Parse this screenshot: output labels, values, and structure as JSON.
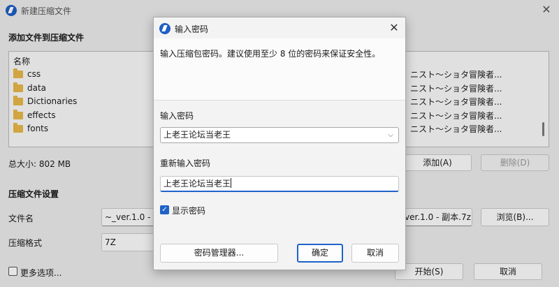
{
  "background_window": {
    "title": "新建压缩文件",
    "close_glyph": "✕",
    "add_files_heading": "添加文件到压缩文件",
    "file_list": {
      "column_header": "名称",
      "items": [
        {
          "name": "css",
          "right_text": "ニスト～ショタ冒険者..."
        },
        {
          "name": "data",
          "right_text": "ニスト～ショタ冒険者..."
        },
        {
          "name": "Dictionaries",
          "right_text": "ニスト～ショタ冒険者..."
        },
        {
          "name": "effects",
          "right_text": "ニスト～ショタ冒険者..."
        },
        {
          "name": "fonts",
          "right_text": "ニスト～ショタ冒険者..."
        }
      ]
    },
    "total_size": "总大小: 802 MB",
    "add_button": "添加(A)",
    "delete_button": "删除(D)",
    "settings_heading": "压缩文件设置",
    "filename_label": "文件名",
    "filename_value_left": "~_ver.1.0 - ",
    "filename_value_right": "ver.1.0 - 副本.7z",
    "browse_button": "浏览(B)...",
    "format_label": "压缩格式",
    "format_value": "7Z",
    "more_options_label": "更多选项...",
    "start_button": "开始(S)",
    "cancel_button": "取消"
  },
  "dialog": {
    "title": "输入密码",
    "close_glyph": "✕",
    "description": "输入压缩包密码。建议使用至少 8 位的密码来保证安全性。",
    "password_label": "输入密码",
    "password_value": "上老王论坛当老王",
    "reenter_label": "重新输入密码",
    "reenter_value": "上老王论坛当老王",
    "show_password_label": "显示密码",
    "show_password_checked": true,
    "password_manager_button": "密码管理器...",
    "ok_button": "确定",
    "cancel_button": "取消"
  },
  "colors": {
    "accent": "#1f63c9",
    "folder": "#e8b84a"
  }
}
